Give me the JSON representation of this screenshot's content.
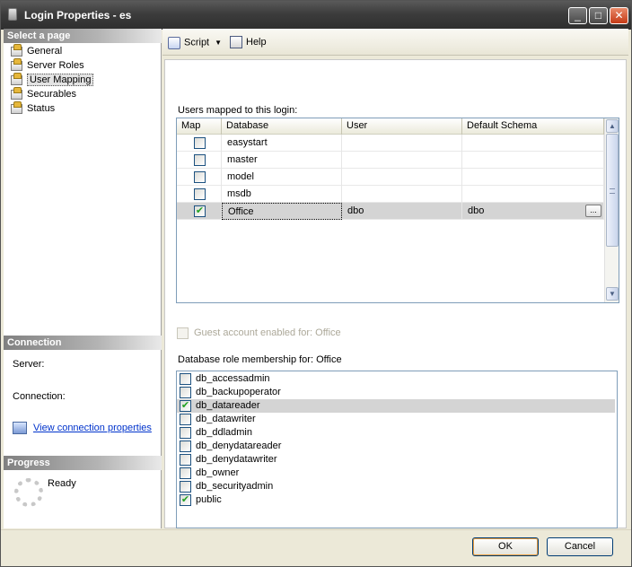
{
  "window": {
    "title": "Login Properties - es",
    "min_label": "_",
    "max_label": "□",
    "close_label": "✕"
  },
  "left": {
    "select_page_header": "Select a page",
    "pages": [
      {
        "label": "General",
        "selected": false
      },
      {
        "label": "Server Roles",
        "selected": false
      },
      {
        "label": "User Mapping",
        "selected": true
      },
      {
        "label": "Securables",
        "selected": false
      },
      {
        "label": "Status",
        "selected": false
      }
    ],
    "connection_header": "Connection",
    "server_label": "Server:",
    "connection_label": "Connection:",
    "view_connection_link": "View connection properties",
    "progress_header": "Progress",
    "progress_status": "Ready"
  },
  "toolbar": {
    "script_label": "Script",
    "dropdown_caret": "▼",
    "help_label": "Help"
  },
  "mapping": {
    "title": "Users mapped to this login:",
    "columns": {
      "map": "Map",
      "database": "Database",
      "user": "User",
      "schema": "Default Schema"
    },
    "rows": [
      {
        "checked": false,
        "mark": "",
        "database": "easystart",
        "user": "",
        "schema": ""
      },
      {
        "checked": false,
        "mark": "",
        "database": "master",
        "user": "",
        "schema": ""
      },
      {
        "checked": false,
        "mark": "",
        "database": "model",
        "user": "",
        "schema": ""
      },
      {
        "checked": false,
        "mark": "",
        "database": "msdb",
        "user": "",
        "schema": ""
      },
      {
        "checked": true,
        "mark": "✔",
        "database": "Office",
        "user": "dbo",
        "schema": "dbo"
      }
    ],
    "ellipsis_label": "...",
    "scroll_up": "▲",
    "scroll_down": "▼"
  },
  "guest_label": "Guest account enabled for: Office",
  "roles": {
    "title": "Database role membership for: Office",
    "items": [
      {
        "label": "db_accessadmin",
        "checked": false,
        "mark": ""
      },
      {
        "label": "db_backupoperator",
        "checked": false,
        "mark": ""
      },
      {
        "label": "db_datareader",
        "checked": true,
        "mark": "✔"
      },
      {
        "label": "db_datawriter",
        "checked": false,
        "mark": ""
      },
      {
        "label": "db_ddladmin",
        "checked": false,
        "mark": ""
      },
      {
        "label": "db_denydatareader",
        "checked": false,
        "mark": ""
      },
      {
        "label": "db_denydatawriter",
        "checked": false,
        "mark": ""
      },
      {
        "label": "db_owner",
        "checked": false,
        "mark": ""
      },
      {
        "label": "db_securityadmin",
        "checked": false,
        "mark": ""
      },
      {
        "label": "public",
        "checked": true,
        "mark": "✔"
      }
    ]
  },
  "buttons": {
    "ok": "OK",
    "cancel": "Cancel"
  },
  "colors": {
    "selection": "#d4d4d4",
    "link": "#0033cc",
    "checkmark": "#21a121"
  }
}
